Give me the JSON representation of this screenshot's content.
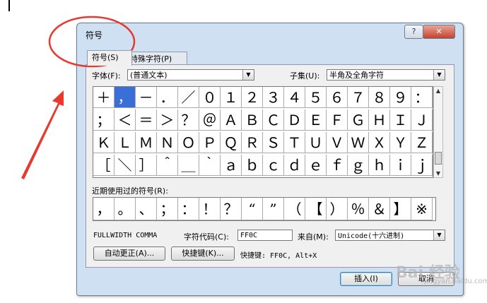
{
  "dialog": {
    "title": "符号",
    "help_label": "?",
    "close_label": "✕"
  },
  "tabs": [
    {
      "label": "符号(S)"
    },
    {
      "label": "特殊字符(P)"
    }
  ],
  "font": {
    "label": "字体(F):",
    "value": "(普通文本)"
  },
  "subset": {
    "label": "子集(U):",
    "value": "半角及全角字符"
  },
  "symbols": [
    "＋",
    "，",
    "－",
    "．",
    "／",
    "０",
    "１",
    "２",
    "３",
    "４",
    "５",
    "６",
    "７",
    "８",
    "９",
    "：",
    "；",
    "＜",
    "＝",
    "＞",
    "？",
    "＠",
    "Ａ",
    "Ｂ",
    "Ｃ",
    "Ｄ",
    "Ｅ",
    "Ｆ",
    "Ｇ",
    "Ｈ",
    "Ｉ",
    "Ｊ",
    "Ｋ",
    "Ｌ",
    "Ｍ",
    "Ｎ",
    "Ｏ",
    "Ｐ",
    "Ｑ",
    "Ｒ",
    "Ｓ",
    "Ｔ",
    "Ｕ",
    "Ｖ",
    "Ｗ",
    "Ｘ",
    "Ｙ",
    "Ｚ",
    "［",
    "＼",
    "］",
    "＾",
    "＿",
    "｀",
    "ａ",
    "ｂ",
    "ｃ",
    "ｄ",
    "ｅ",
    "ｆ",
    "ｇ",
    "ｈ",
    "ｉ",
    "ｊ"
  ],
  "selected_index": 1,
  "recent": {
    "label": "近期使用过的符号(R):",
    "symbols": [
      "，",
      "。",
      "、",
      "；",
      "：",
      "！",
      "？",
      "“",
      "”",
      "（",
      "【",
      "）",
      "％",
      "＆",
      "】",
      "※"
    ]
  },
  "char_name": "FULLWIDTH COMMA",
  "char_code": {
    "label": "字符代码(C):",
    "value": "FF0C"
  },
  "from": {
    "label": "来自(M):",
    "value": "Unicode(十六进制)"
  },
  "buttons": {
    "autocorrect": "自动更正(A)...",
    "shortcut_key": "快捷键(K)...",
    "insert": "插入(I)",
    "cancel": "取消"
  },
  "shortcut_text": "快捷键: FF0C, Alt+X",
  "watermark": {
    "text": "Bai 经验",
    "sub": "jingyan.baidu.com"
  },
  "colors": {
    "annotation": "#e8392f",
    "selection": "#3a6fd8"
  }
}
